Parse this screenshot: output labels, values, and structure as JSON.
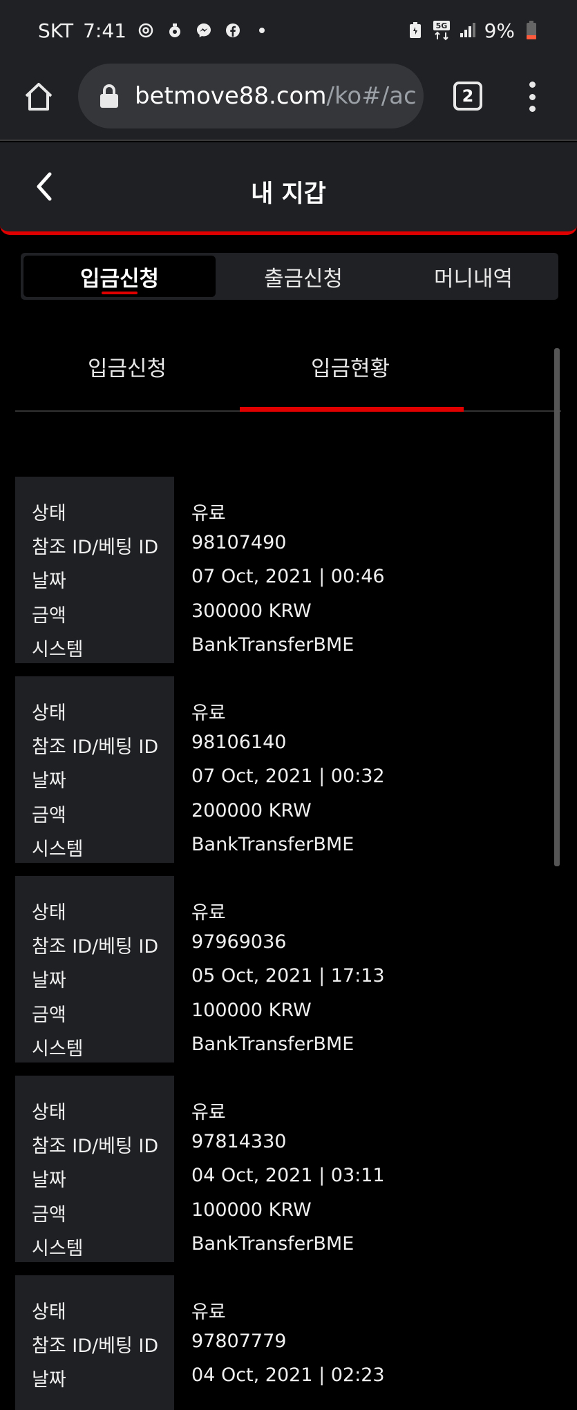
{
  "status_bar": {
    "carrier": "SKT",
    "time": "7:41",
    "battery": "9%",
    "network": "5G"
  },
  "browser": {
    "url_host": "betmove88.com",
    "url_path": "/ko#/ac",
    "tab_count": "2"
  },
  "header": {
    "title": "내 지갑"
  },
  "segment_tabs": [
    {
      "label": "입금신청"
    },
    {
      "label": "출금신청"
    },
    {
      "label": "머니내역"
    }
  ],
  "sub_tabs": [
    {
      "label": "입금신청"
    },
    {
      "label": "입금현황"
    }
  ],
  "field_labels": {
    "status": "상태",
    "reference": "참조 ID/베팅 ID",
    "date": "날짜",
    "amount": "금액",
    "system": "시스템"
  },
  "records": [
    {
      "status": "유료",
      "reference": "98107490",
      "date": "07 Oct, 2021 | 00:46",
      "amount": "300000 KRW",
      "system": "BankTransferBME"
    },
    {
      "status": "유료",
      "reference": "98106140",
      "date": "07 Oct, 2021 | 00:32",
      "amount": "200000 KRW",
      "system": "BankTransferBME"
    },
    {
      "status": "유료",
      "reference": "97969036",
      "date": "05 Oct, 2021 | 17:13",
      "amount": "100000 KRW",
      "system": "BankTransferBME"
    },
    {
      "status": "유료",
      "reference": "97814330",
      "date": "04 Oct, 2021 | 03:11",
      "amount": "100000 KRW",
      "system": "BankTransferBME"
    },
    {
      "status": "유료",
      "reference": "97807779",
      "date": "04 Oct, 2021 | 02:23",
      "amount": "",
      "system": ""
    }
  ]
}
